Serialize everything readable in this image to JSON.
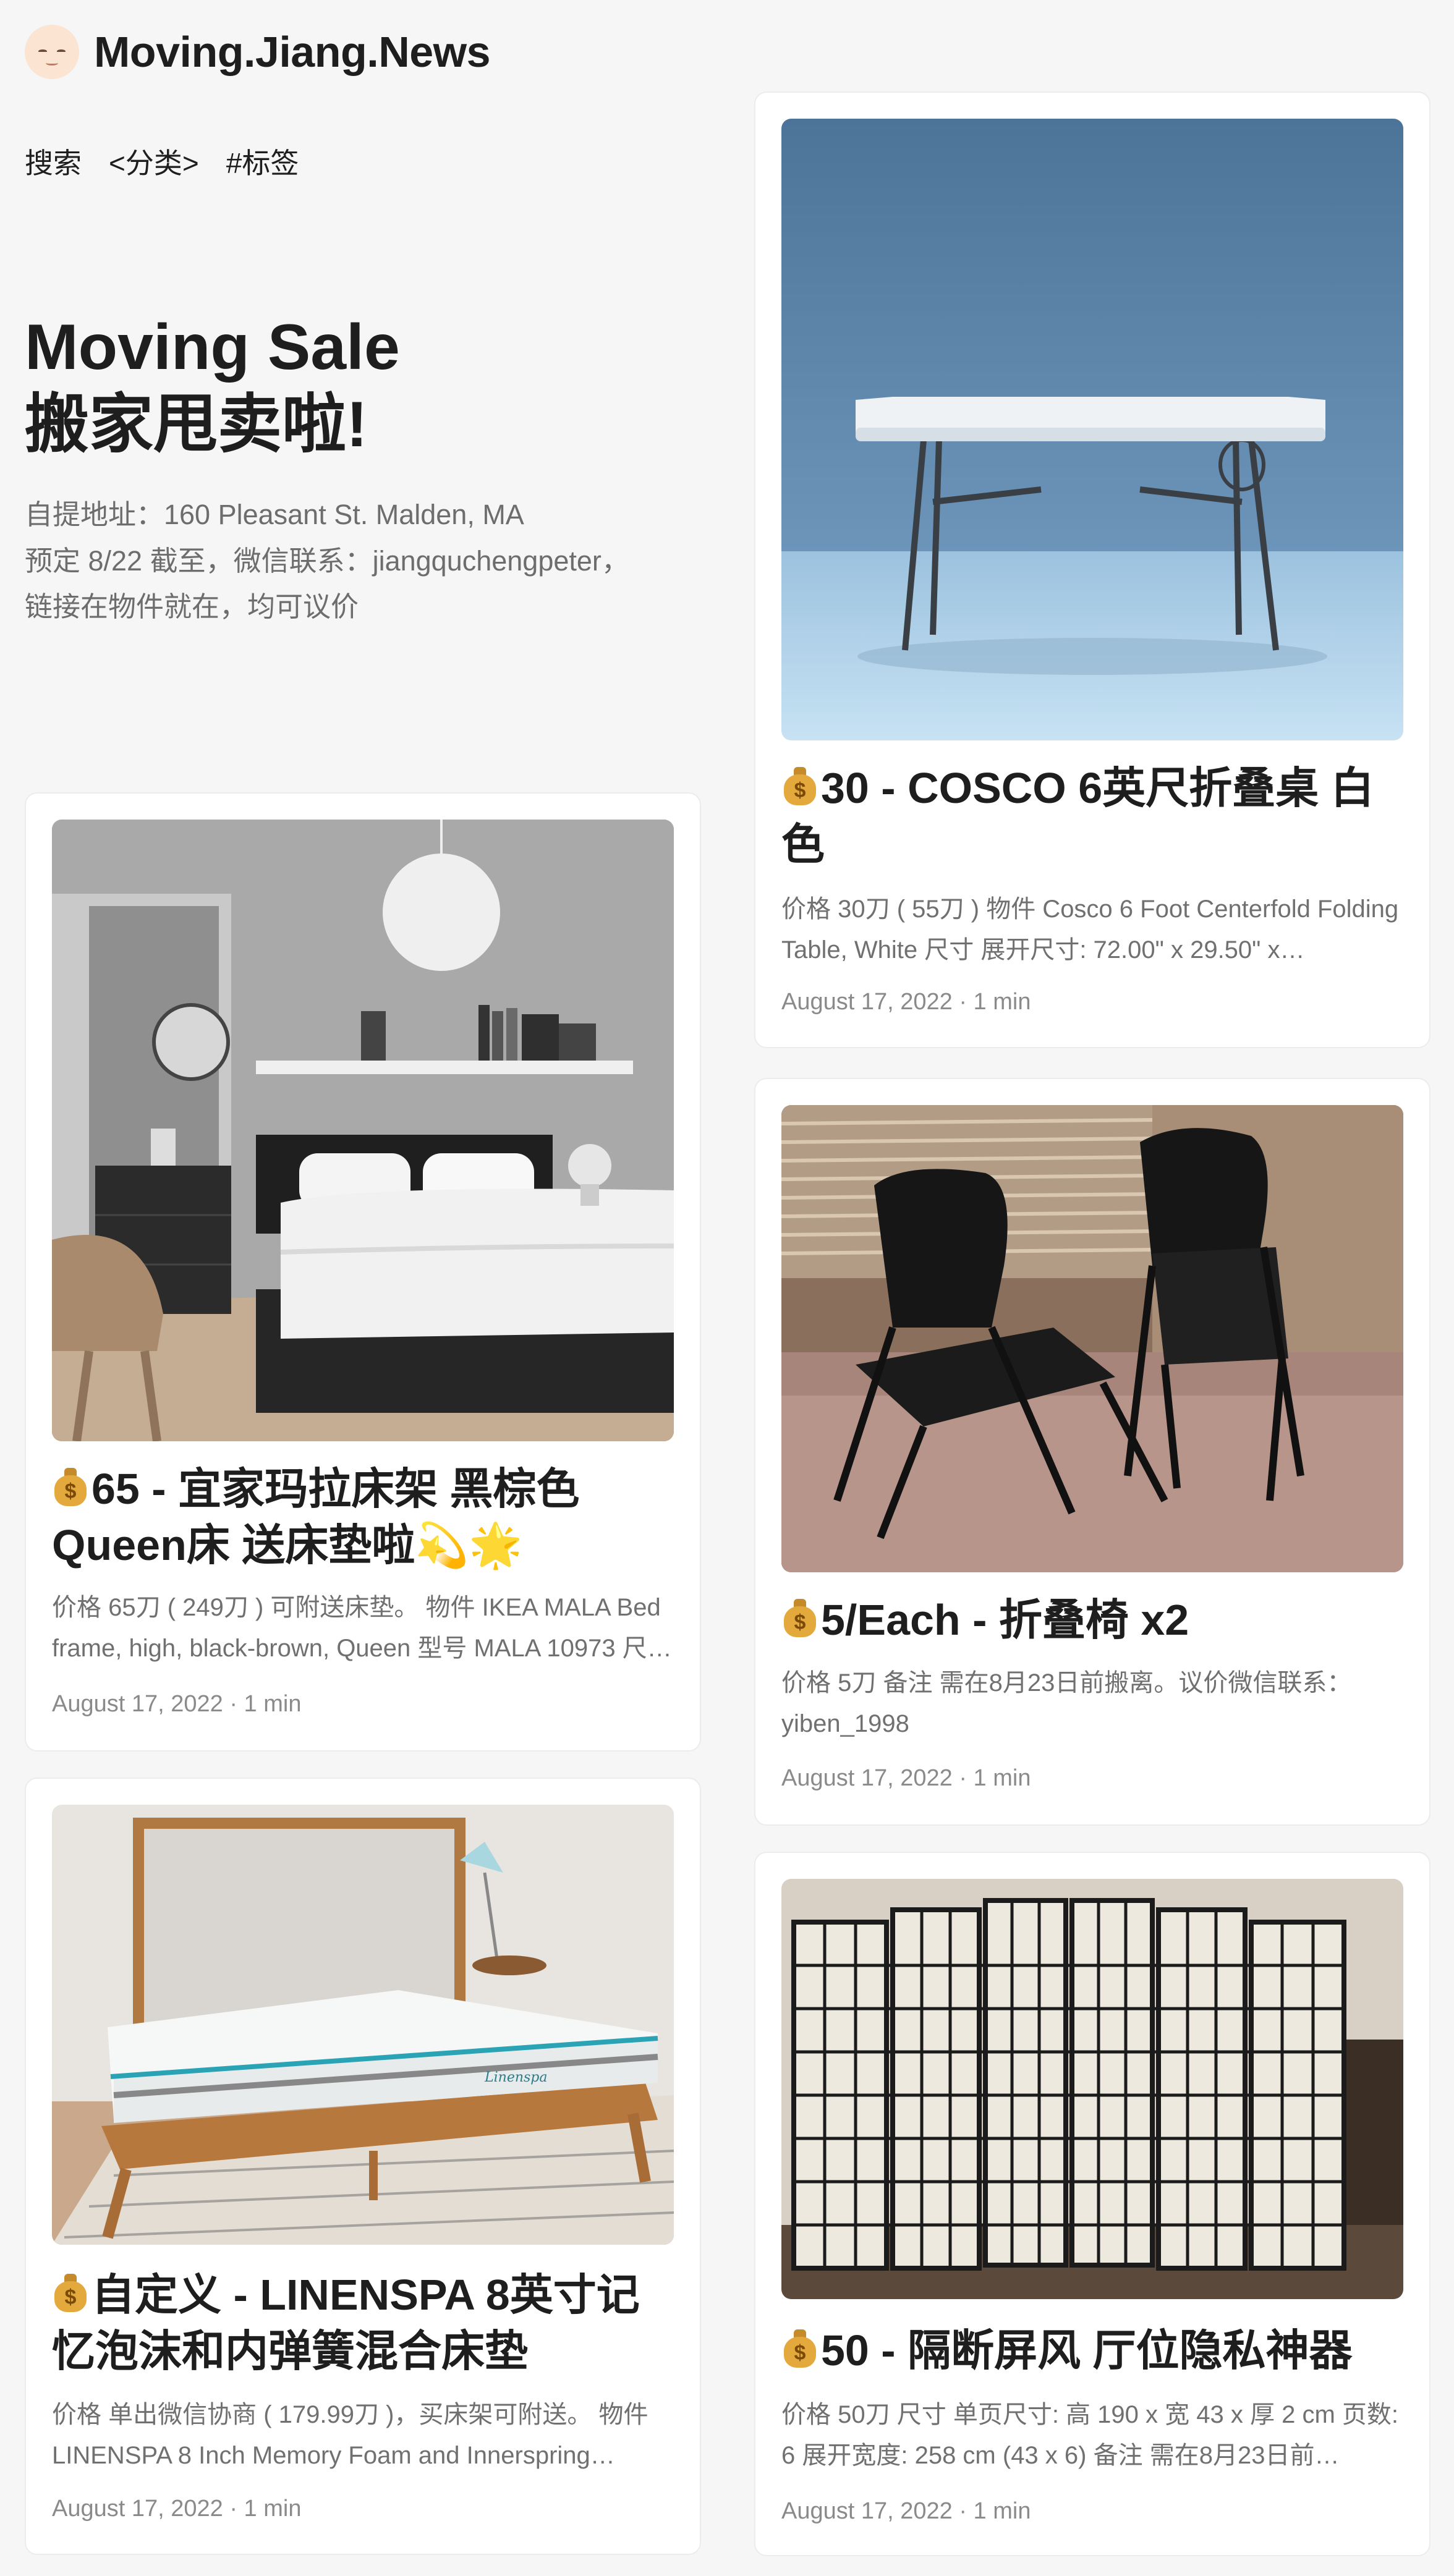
{
  "site": {
    "name": "Moving.Jiang.News",
    "nav": [
      "搜索",
      "<分类>",
      "#标签"
    ]
  },
  "hero": {
    "title_line1": "Moving Sale",
    "title_line2": "搬家甩卖啦!",
    "desc_line1": "自提地址：160 Pleasant St. Malden, MA",
    "desc_line2": "预定 8/22 截至，微信联系：jiangquchengpeter，",
    "desc_line3": "链接在物件就在，均可议价"
  },
  "posts": [
    {
      "icon": "money-bag-icon",
      "title": "30 - COSCO 6英尺折叠桌 白色",
      "summary": "价格 30刀 ( 55刀 ) 物件 Cosco 6 Foot Centerfold Folding Table, White 尺寸 展开尺寸: 72.00\" x 29.50\" x…",
      "date": "August 17, 2022 · 1 min",
      "image": "folding-table-photo"
    },
    {
      "icon": "money-bag-icon",
      "title": "65 - 宜家玛拉床架 黑棕色 Queen床 送床垫啦💫🌟",
      "summary": "价格 65刀 ( 249刀 ) 可附送床垫。 物件 IKEA MALA Bed frame, high, black-brown, Queen 型号 MALA 10973 尺…",
      "date": "August 17, 2022 · 1 min",
      "image": "bedroom-bed-photo"
    },
    {
      "icon": "money-bag-icon",
      "title": "5/Each - 折叠椅 x2",
      "summary": "价格 5刀 备注 需在8月23日前搬离。议价微信联系：yiben_1998",
      "date": "August 17, 2022 · 1 min",
      "image": "folding-chairs-photo"
    },
    {
      "icon": "money-bag-icon",
      "title": "自定义 - LINENSPA 8英寸记忆泡沫和内弹簧混合床垫",
      "summary": "价格 单出微信协商 ( 179.99刀 )，买床架可附送。 物件 LINENSPA 8 Inch Memory Foam and Innerspring…",
      "date": "August 17, 2022 · 1 min",
      "image": "mattress-photo",
      "mattress_brand": "Linenspa"
    },
    {
      "icon": "money-bag-icon",
      "title": "50 - 隔断屏风 厅位隐私神器",
      "summary": "价格 50刀 尺寸 单页尺寸: 高 190 x 宽 43 x 厚 2 cm 页数: 6 展开宽度: 258 cm (43 x 6) 备注 需在8月23日前…",
      "date": "August 17, 2022 · 1 min",
      "image": "room-divider-photo"
    }
  ]
}
